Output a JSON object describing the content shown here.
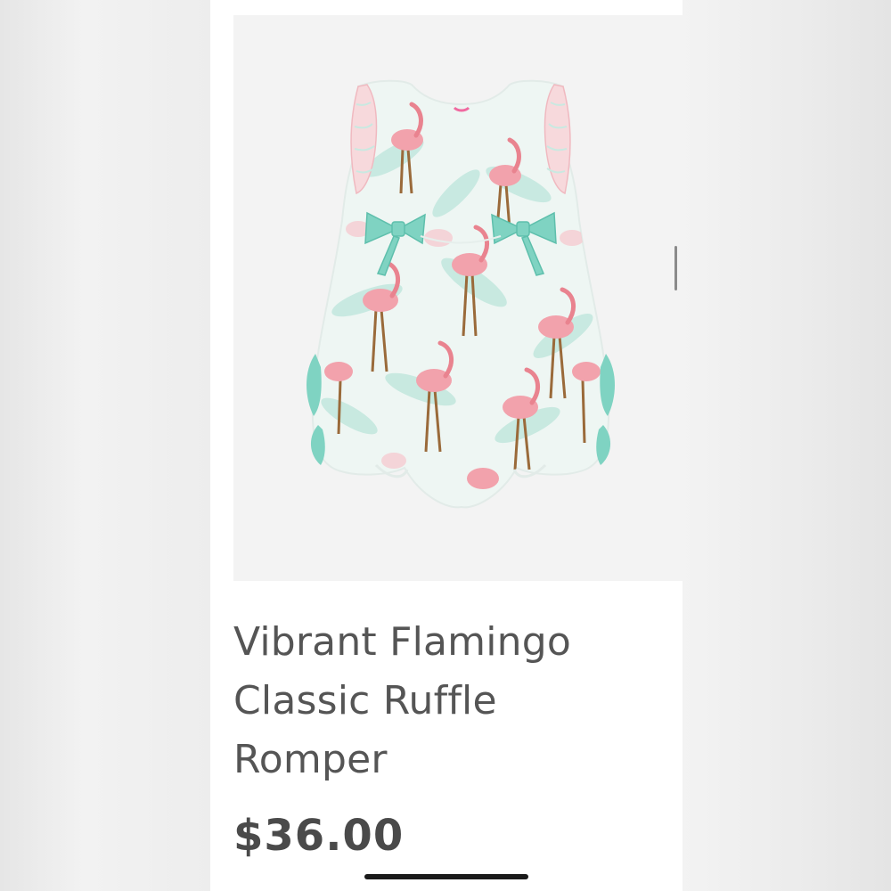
{
  "product": {
    "title": "Vibrant Flamingo Classic Ruffle Romper",
    "price": "$36.00",
    "image": {
      "icon": "flamingo-romper-photo",
      "colors": {
        "fabric": "#eef6f3",
        "flamingo": "#f2a2ac",
        "flamingo_dark": "#e9838f",
        "leaf": "#a9ded3",
        "ribbon": "#7fd3c2",
        "legs": "#9a6a3a"
      }
    }
  }
}
